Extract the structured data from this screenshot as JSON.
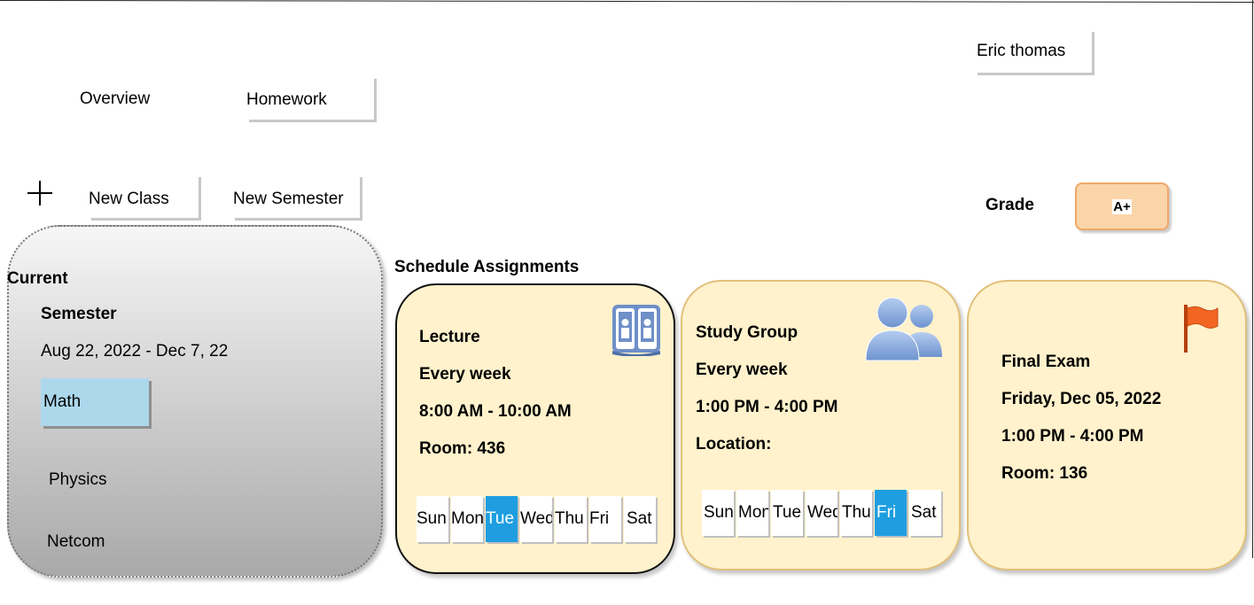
{
  "user": {
    "name": "Eric thomas"
  },
  "nav": {
    "overview": "Overview",
    "homework": "Homework"
  },
  "actions": {
    "new_class": "New Class",
    "new_semester": "New Semester"
  },
  "grade": {
    "label": "Grade",
    "value": "A+"
  },
  "semester": {
    "heading": "Current",
    "title": "Semester",
    "dates": "Aug 22, 2022 - Dec 7, 22",
    "classes": [
      "Math",
      "Physics",
      "Netcom"
    ],
    "selected_class": "Math"
  },
  "schedule": {
    "heading": "Schedule Assignments",
    "cards": [
      {
        "title": "Lecture",
        "recurrence": "Every week",
        "time": "8:00 AM - 10:00 AM",
        "place": "Room: 436",
        "icon": "book-icon",
        "days": [
          "Sun",
          "Mon",
          "Tue",
          "Wed",
          "Thu",
          "Fri",
          "Sat"
        ],
        "active_day": "Tue"
      },
      {
        "title": "Study Group",
        "recurrence": "Every week",
        "time": "1:00 PM - 4:00 PM",
        "place": "Location:",
        "icon": "users-icon",
        "days": [
          "Sun",
          "Mon",
          "Tue",
          "Wed",
          "Thu",
          "Fri",
          "Sat"
        ],
        "active_day": "Fri"
      },
      {
        "title": "Final Exam",
        "date": "Friday, Dec 05, 2022",
        "time": "1:00 PM - 4:00 PM",
        "place": "Room: 136",
        "icon": "flag-icon"
      }
    ]
  },
  "colors": {
    "card_bg": "#fff2cc",
    "active_day": "#1e9ee0",
    "selected_class": "#add8ec",
    "grade_bg": "#fbd5aa",
    "flag": "#f26522"
  }
}
